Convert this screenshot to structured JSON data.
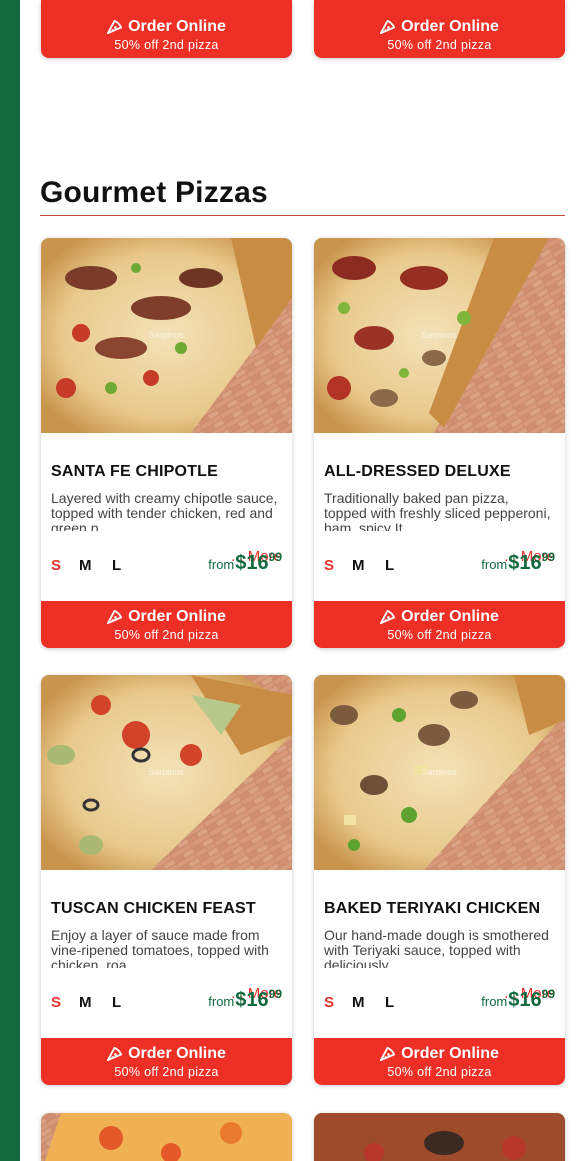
{
  "colors": {
    "brand_green": "#136a3e",
    "brand_red": "#ee2f25",
    "accent_red": "#e5322b"
  },
  "section": {
    "title": "Gourmet Pizzas"
  },
  "top_buttons": [
    {
      "label": "Order Online",
      "promo": "50% off 2nd pizza"
    },
    {
      "label": "Order Online",
      "promo": "50% off 2nd pizza"
    }
  ],
  "cards": [
    {
      "title": "SANTA FE CHIPOTLE",
      "desc": "Layered with creamy chipotle sauce, topped with tender chicken, red and green p",
      "more": "... More",
      "sizes": [
        "S",
        "M",
        "L"
      ],
      "from": "from",
      "price_dollars": "$16",
      "price_cents": "99",
      "image_icon": "pizza-photo",
      "watermark": "Sarpinos",
      "order_label": "Order Online",
      "order_promo": "50% off 2nd pizza"
    },
    {
      "title": "ALL-DRESSED DELUXE",
      "desc": "Traditionally baked pan pizza, topped with freshly sliced pepperoni, ham, spicy It",
      "more": "... More",
      "sizes": [
        "S",
        "M",
        "L"
      ],
      "from": "from",
      "price_dollars": "$16",
      "price_cents": "99",
      "image_icon": "pizza-photo",
      "watermark": "Sarpinos",
      "order_label": "Order Online",
      "order_promo": "50% off 2nd pizza"
    },
    {
      "title": "TUSCAN CHICKEN FEAST",
      "desc": "Enjoy a layer of sauce made from vine-ripened tomatoes, topped with chicken, roa",
      "more": "... More",
      "sizes": [
        "S",
        "M",
        "L"
      ],
      "from": "from",
      "price_dollars": "$16",
      "price_cents": "99",
      "image_icon": "pizza-photo",
      "watermark": "Sarpinos",
      "order_label": "Order Online",
      "order_promo": "50% off 2nd pizza"
    },
    {
      "title": "BAKED TERIYAKI CHICKEN",
      "desc": "Our hand-made dough is smothered with Teriyaki sauce, topped with deliciously",
      "more": "... More",
      "sizes": [
        "S",
        "M",
        "L"
      ],
      "from": "from",
      "price_dollars": "$16",
      "price_cents": "99",
      "image_icon": "pizza-photo",
      "watermark": "Sarpinos",
      "order_label": "Order Online",
      "order_promo": "50% off 2nd pizza"
    }
  ]
}
